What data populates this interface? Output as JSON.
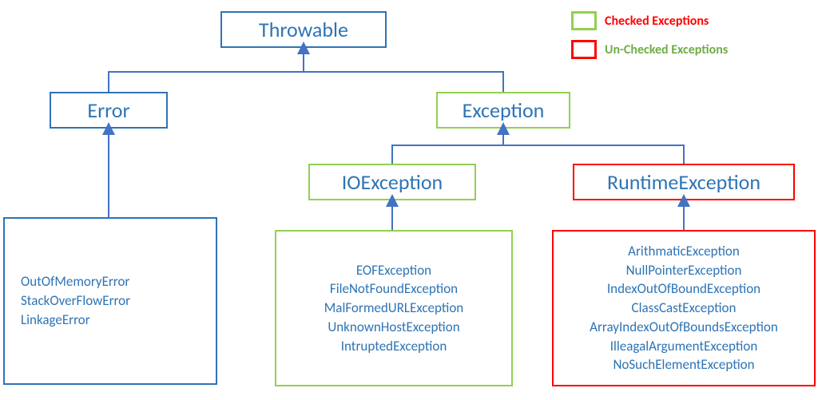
{
  "colors": {
    "blue": "#2e74b5",
    "green": "#92d050",
    "red": "#ff0000",
    "arrow": "#4472c4"
  },
  "nodes": {
    "throwable": "Throwable",
    "error": "Error",
    "exception": "Exception",
    "ioexception": "IOException",
    "runtimeexception": "RuntimeException"
  },
  "lists": {
    "error_items": [
      "OutOfMemoryError",
      "StackOverFlowError",
      "LinkageError"
    ],
    "io_items": [
      "EOFException",
      "FileNotFoundException",
      "MalFormedURLException",
      "UnknownHostException",
      "IntruptedException"
    ],
    "runtime_items": [
      "ArithmaticException",
      "NullPointerException",
      "IndexOutOfBoundException",
      "ClassCastException",
      "ArrayIndexOutOfBoundsException",
      "IlleagalArgumentException",
      "NoSuchElementException"
    ]
  },
  "legend": {
    "checked": "Checked Exceptions",
    "unchecked": "Un-Checked Exceptions"
  }
}
